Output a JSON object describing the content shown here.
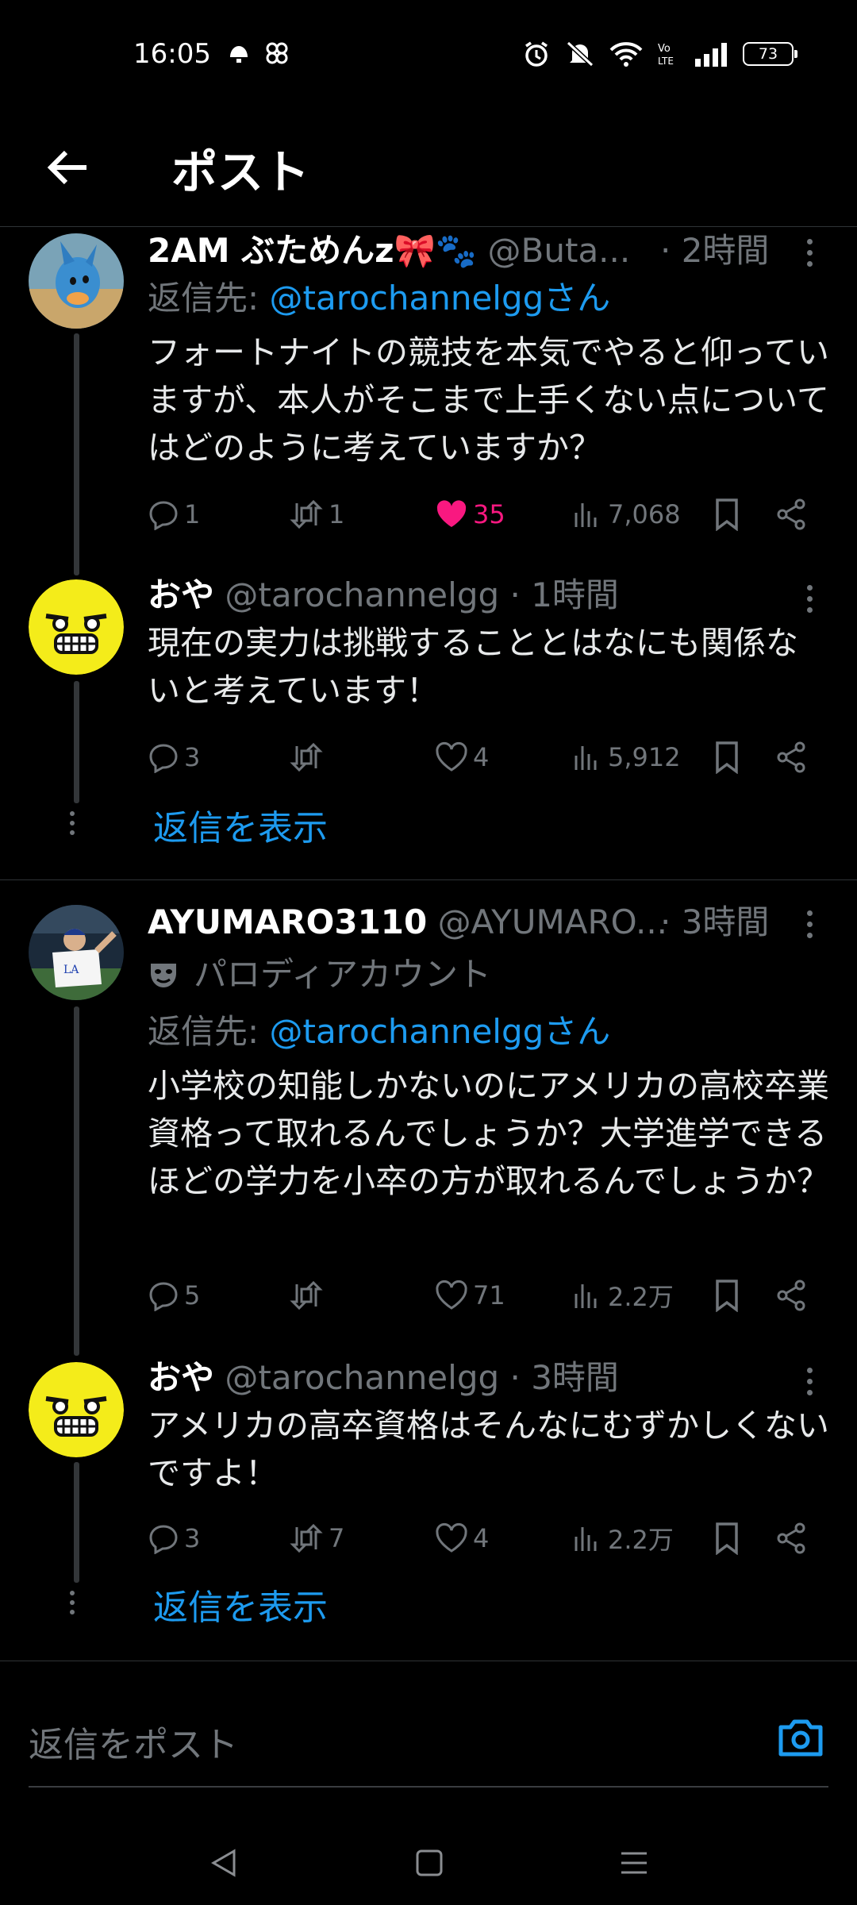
{
  "status_bar": {
    "time": "16:05",
    "battery": "73"
  },
  "header": {
    "title": "ポスト"
  },
  "threads": [
    {
      "parent": {
        "name": "2AM ぶためんz🎀🐾",
        "handle": "@Buta...",
        "time": "· 2時間",
        "reply_prefix": "返信先: ",
        "reply_to": "@tarochannelggさん",
        "text": "フォートナイトの競技を本気でやると仰っていますが、本人がそこまで上手くない点についてはどのように考えていますか？",
        "stats": {
          "replies": "1",
          "reposts": "1",
          "likes": "35",
          "views": "7,068"
        }
      },
      "reply": {
        "name": "おや",
        "handle": "@tarochannelgg · 1時間",
        "text": "現在の実力は挑戦することとはなにも関係ないと考えています！",
        "stats": {
          "replies": "3",
          "reposts": "",
          "likes": "4",
          "views": "5,912"
        }
      },
      "show_replies": "返信を表示"
    },
    {
      "parent": {
        "name": "AYUMARO3110",
        "handle": "@AYUMARO...",
        "time": "· 3時間",
        "label": "パロディアカウント",
        "reply_prefix": "返信先: ",
        "reply_to": "@tarochannelggさん",
        "text": "小学校の知能しかないのにアメリカの高校卒業資格って取れるんでしょうか？大学進学できるほどの学力を小卒の方が取れるんでしょうか？",
        "stats": {
          "replies": "5",
          "reposts": "",
          "likes": "71",
          "views": "2.2万"
        }
      },
      "reply": {
        "name": "おや",
        "handle": "@tarochannelgg · 3時間",
        "text": "アメリカの高卒資格はそんなにむずかしくないですよ！",
        "stats": {
          "replies": "3",
          "reposts": "7",
          "likes": "4",
          "views": "2.2万"
        }
      },
      "show_replies": "返信を表示"
    }
  ],
  "composer": {
    "placeholder": "返信をポスト"
  },
  "colors": {
    "accent": "#1d9bf0",
    "like": "#f91880",
    "muted": "#71767b",
    "background": "#000000"
  },
  "icons": [
    "back-arrow-icon",
    "more-icon",
    "reply-icon",
    "repost-icon",
    "like-icon",
    "views-icon",
    "bookmark-icon",
    "share-icon",
    "camera-icon",
    "nav-back-icon",
    "nav-home-icon",
    "nav-menu-icon"
  ]
}
